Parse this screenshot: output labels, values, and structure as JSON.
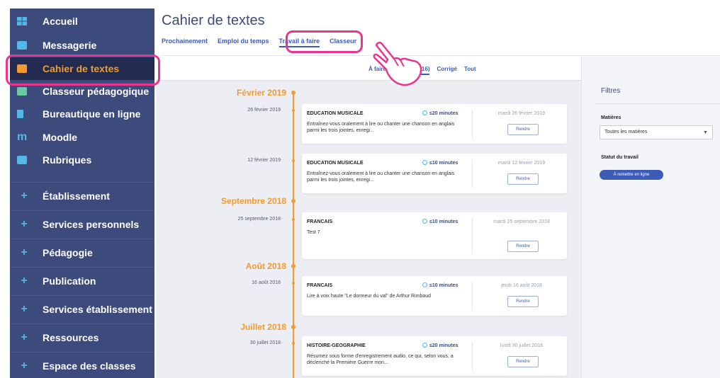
{
  "sidebar": {
    "items": [
      {
        "label": "Accueil",
        "icon": "grid-icon"
      },
      {
        "label": "Messagerie",
        "icon": "mail-icon"
      },
      {
        "label": "Cahier de textes",
        "icon": "book-icon"
      },
      {
        "label": "Classeur pédagogique",
        "icon": "folder-icon"
      },
      {
        "label": "Bureautique en ligne",
        "icon": "document-icon"
      },
      {
        "label": "Moodle",
        "icon": "moodle-icon"
      },
      {
        "label": "Rubriques",
        "icon": "chat-icon"
      }
    ],
    "sections": [
      {
        "label": "Établissement"
      },
      {
        "label": "Services personnels"
      },
      {
        "label": "Pédagogie"
      },
      {
        "label": "Publication"
      },
      {
        "label": "Services établissement"
      },
      {
        "label": "Ressources"
      },
      {
        "label": "Espace des classes"
      }
    ],
    "plus_symbol": "+"
  },
  "page": {
    "title": "Cahier de textes",
    "tabs": [
      "Prochainement",
      "Emploi du temps",
      "Travail à faire",
      "Classeur"
    ],
    "filter_tabs": [
      "À faire",
      "En retard (16)",
      "Corrigé",
      "Tout"
    ]
  },
  "timeline": {
    "months": [
      "Février 2019",
      "Septembre 2018",
      "Août 2018",
      "Juillet 2018"
    ],
    "dates": [
      "26 février 2019",
      "12 février 2019",
      "25 septembre 2018",
      "16 août 2018",
      "30 juillet 2018"
    ],
    "cards": [
      {
        "subject": "EDUCATION MUSICALE",
        "duration": "≤20 minutes",
        "description": "Entraînez-vous oralement à lire ou chanter une chanson en anglais parmi les trois jointes, enregi...",
        "due": "mardi 26 février 2019",
        "button": "Rendre"
      },
      {
        "subject": "EDUCATION MUSICALE",
        "duration": "≤10 minutes",
        "description": "Entraînez-vous oralement à lire ou chanter une chanson en anglais parmi les trois jointes, enregi...",
        "due": "mardi 12 février 2019",
        "button": "Rendre"
      },
      {
        "subject": "FRANCAIS",
        "duration": "≤10 minutes",
        "description": "Test 7",
        "due": "mardi 25 septembre 2018",
        "button": "Rendre"
      },
      {
        "subject": "FRANCAIS",
        "duration": "≤10 minutes",
        "description": "Lire à voix haute \"Le dormeur du val\" de Arthur Rimbaud",
        "due": "jeudi 16 août 2018",
        "button": "Rendre"
      },
      {
        "subject": "HISTOIRE-GEOGRAPHIE",
        "duration": "≤20 minutes",
        "description": "Résumez sous forme d'enregistrement audio, ce qui, selon vous, a déclenché la Première Guerre mon...",
        "due": "lundi 30 juillet 2018",
        "button": "Rendre"
      }
    ]
  },
  "filters": {
    "title": "Filtres",
    "matieres_label": "Matières",
    "matieres_value": "Toutes les matières",
    "statut_label": "Statut du travail",
    "statut_value": "À remettre en ligne"
  },
  "colors": {
    "sidebar": "#3d4b7c",
    "active": "#f29b2c",
    "highlight": "#e8358e",
    "link": "#3d5cb8"
  }
}
